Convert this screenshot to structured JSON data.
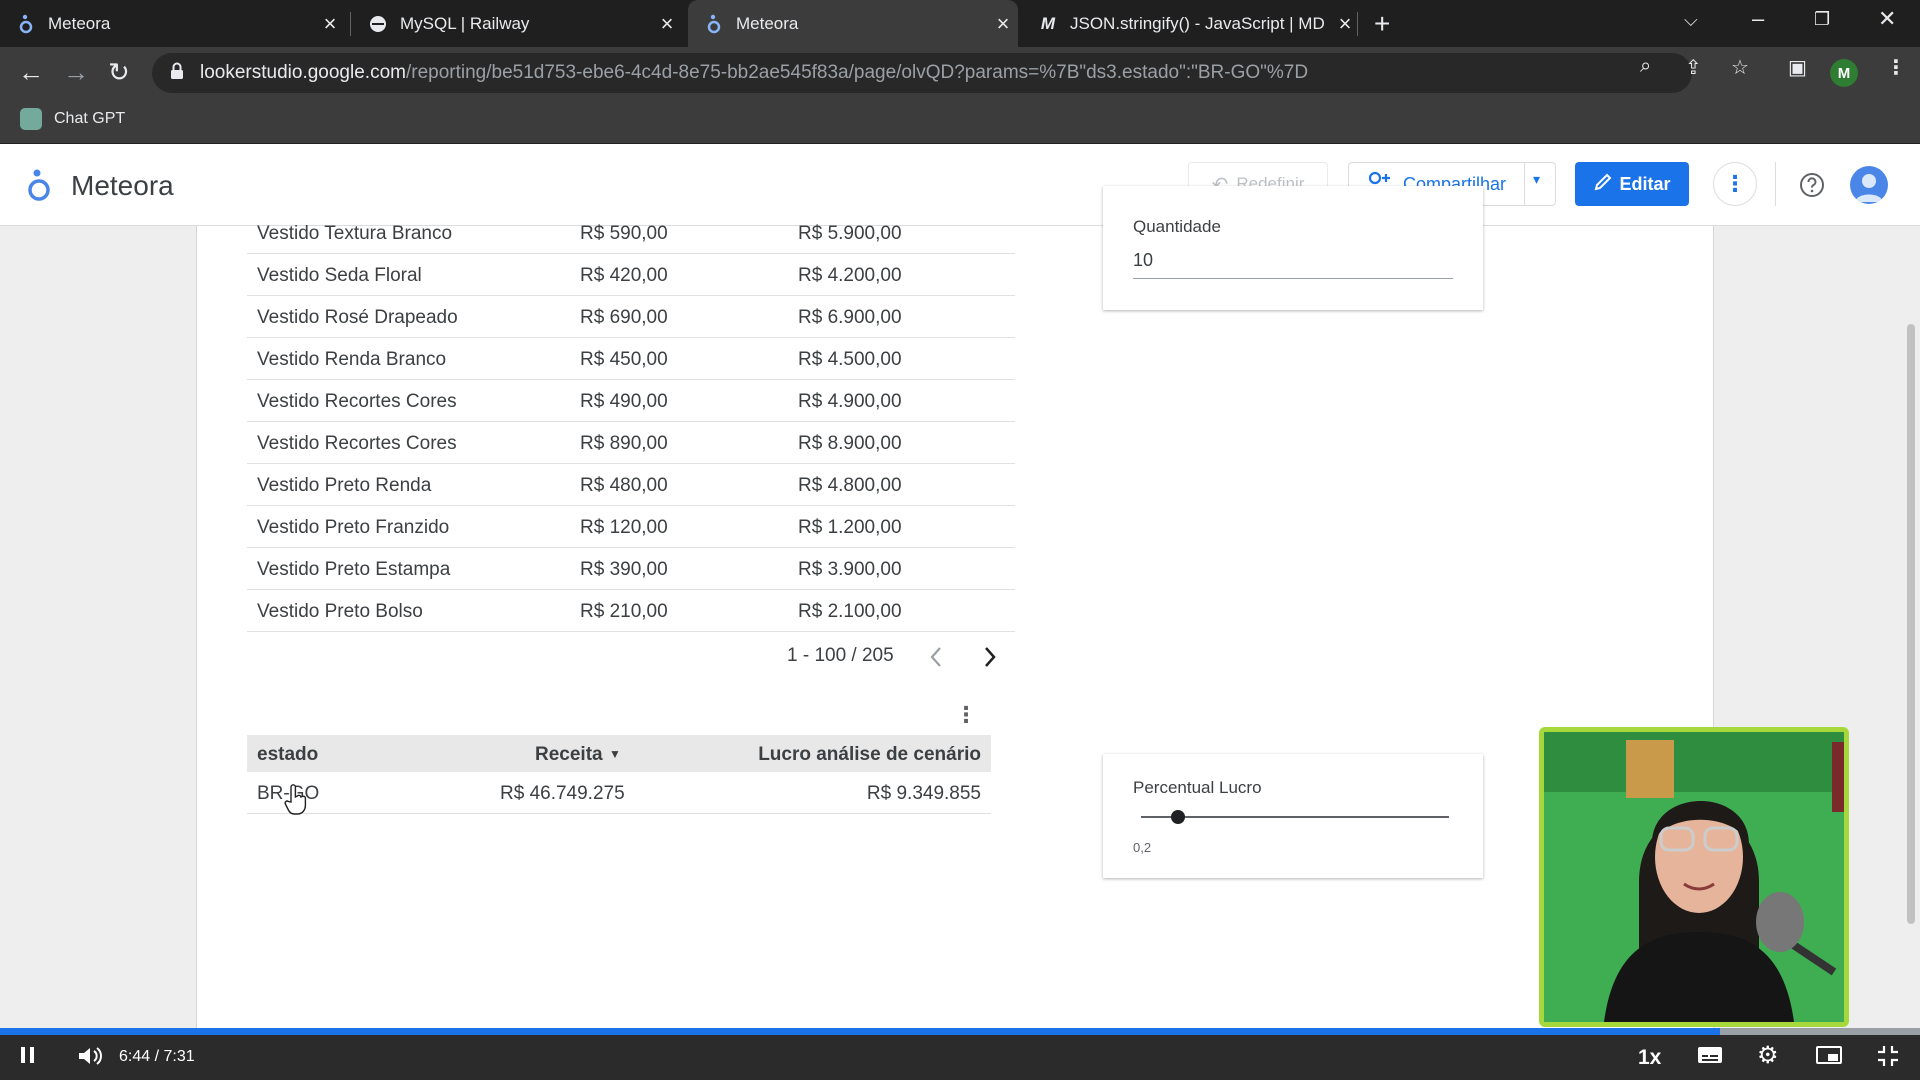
{
  "browser": {
    "tabs": [
      {
        "title": "Meteora",
        "active": false
      },
      {
        "title": "MySQL | Railway",
        "active": false
      },
      {
        "title": "Meteora",
        "active": true
      },
      {
        "title": "JSON.stringify() - JavaScript | MD",
        "active": false
      }
    ],
    "url_host": "lookerstudio.google.com",
    "url_path": "/reporting/be51d753-ebe6-4c4d-8e75-bb2ae545f83a/page/olvQD?params=%7B\"ds3.estado\":\"BR-GO\"%7D",
    "profile_initial": "M",
    "bookmarks": [
      {
        "label": "Chat GPT"
      }
    ]
  },
  "app": {
    "title": "Meteora",
    "reset_label": "Redefinir",
    "share_label": "Compartilhar",
    "edit_label": "Editar"
  },
  "products_table": {
    "partial_top_row": [
      "Vestido Textura Branco",
      "R$ 590,00",
      "R$ 5.900,00"
    ],
    "rows": [
      [
        "Vestido Seda Floral",
        "R$ 420,00",
        "R$ 4.200,00"
      ],
      [
        "Vestido Rosé Drapeado",
        "R$ 690,00",
        "R$ 6.900,00"
      ],
      [
        "Vestido Renda Branco",
        "R$ 450,00",
        "R$ 4.500,00"
      ],
      [
        "Vestido Recortes Cores",
        "R$ 490,00",
        "R$ 4.900,00"
      ],
      [
        "Vestido Recortes Cores",
        "R$ 890,00",
        "R$ 8.900,00"
      ],
      [
        "Vestido Preto Renda",
        "R$ 480,00",
        "R$ 4.800,00"
      ],
      [
        "Vestido Preto Franzido",
        "R$ 120,00",
        "R$ 1.200,00"
      ],
      [
        "Vestido Preto Estampa",
        "R$ 390,00",
        "R$ 3.900,00"
      ],
      [
        "Vestido Preto Bolso",
        "R$ 210,00",
        "R$ 2.100,00"
      ]
    ],
    "pagination": "1 - 100 / 205"
  },
  "summary_table": {
    "headers": [
      "estado",
      "Receita",
      "Lucro análise de cenário"
    ],
    "row": [
      "BR-GO",
      "R$ 46.749.275",
      "R$ 9.349.855"
    ]
  },
  "quantity_control": {
    "label": "Quantidade",
    "value": "10"
  },
  "profit_control": {
    "label": "Percentual Lucro",
    "value": "0,2",
    "slider_fraction": 0.2
  },
  "video": {
    "current": "6:44",
    "separator": "/",
    "total": "7:31",
    "speed": "1x",
    "progress_fraction": 0.896
  },
  "colors": {
    "accent": "#1a73e8",
    "cam_border": "#a7d83b"
  }
}
